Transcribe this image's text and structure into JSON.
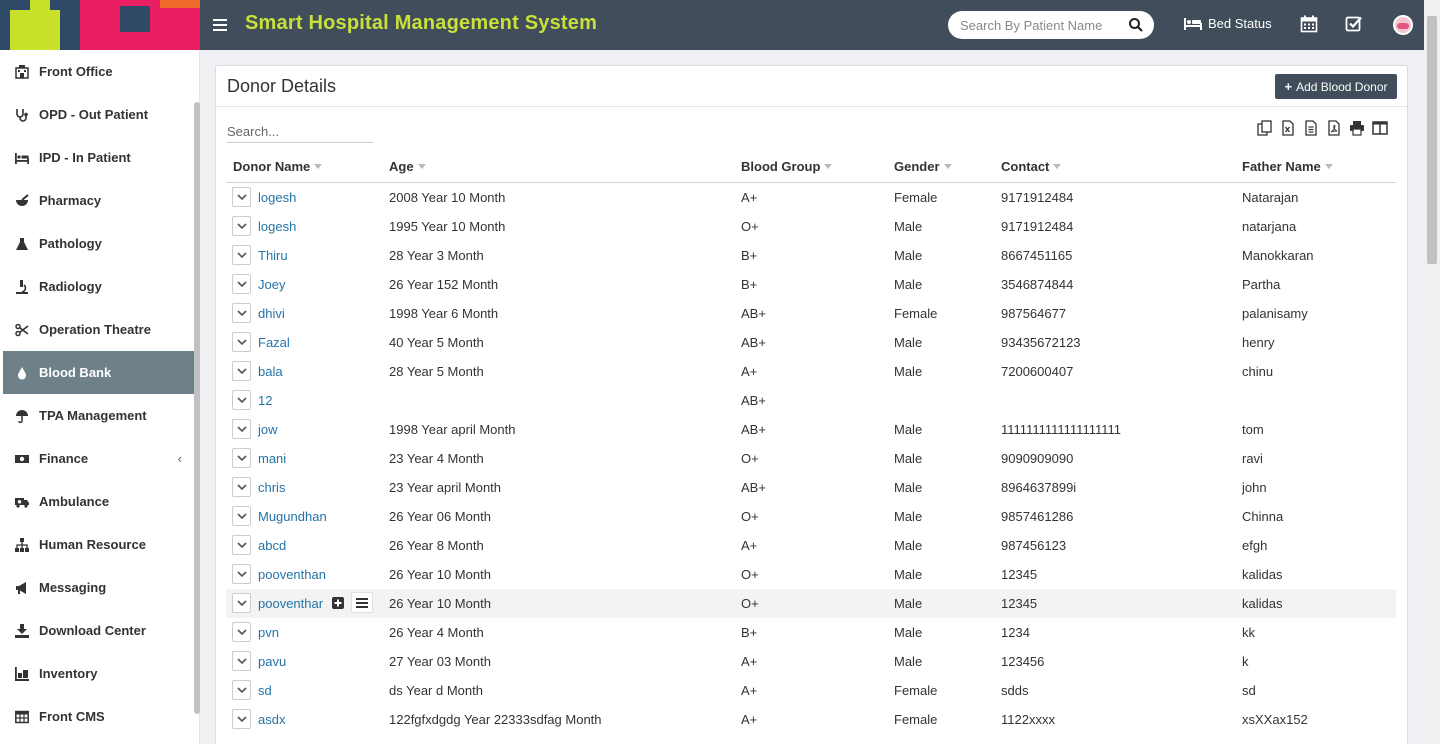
{
  "header": {
    "app_title": "Smart Hospital Management System",
    "search_placeholder": "Search By Patient Name",
    "bed_status_label": "Bed Status"
  },
  "sidebar": {
    "items": [
      {
        "label": "Front Office",
        "icon": "front-office-icon"
      },
      {
        "label": "OPD - Out Patient",
        "icon": "stethoscope-icon"
      },
      {
        "label": "IPD - In Patient",
        "icon": "hospital-bed-icon"
      },
      {
        "label": "Pharmacy",
        "icon": "mortar-pestle-icon"
      },
      {
        "label": "Pathology",
        "icon": "flask-icon"
      },
      {
        "label": "Radiology",
        "icon": "microscope-icon"
      },
      {
        "label": "Operation Theatre",
        "icon": "scissors-icon"
      },
      {
        "label": "Blood Bank",
        "icon": "blood-drop-icon",
        "active": true
      },
      {
        "label": "TPA Management",
        "icon": "umbrella-icon"
      },
      {
        "label": "Finance",
        "icon": "money-icon",
        "has_submenu": true
      },
      {
        "label": "Ambulance",
        "icon": "ambulance-icon"
      },
      {
        "label": "Human Resource",
        "icon": "sitemap-icon"
      },
      {
        "label": "Messaging",
        "icon": "bullhorn-icon"
      },
      {
        "label": "Download Center",
        "icon": "download-icon"
      },
      {
        "label": "Inventory",
        "icon": "inventory-icon"
      },
      {
        "label": "Front CMS",
        "icon": "cms-icon"
      }
    ]
  },
  "main": {
    "title": "Donor Details",
    "add_button_label": "Add Blood Donor",
    "table_search_placeholder": "Search...",
    "columns": [
      "Donor Name",
      "Age",
      "Blood Group",
      "Gender",
      "Contact",
      "Father Name"
    ],
    "rows": [
      [
        "logesh",
        "2008 Year 10 Month",
        "A+",
        "Female",
        "9171912484",
        "Natarajan"
      ],
      [
        "logesh",
        "1995 Year 10 Month",
        "O+",
        "Male",
        "9171912484",
        "natarjana"
      ],
      [
        "Thiru",
        "28 Year 3 Month",
        "B+",
        "Male",
        "8667451165",
        "Manokkaran"
      ],
      [
        "Joey",
        "26 Year 152 Month",
        "B+",
        "Male",
        "3546874844",
        "Partha"
      ],
      [
        "dhivi",
        "1998 Year 6 Month",
        "AB+",
        "Female",
        "987564677",
        "palanisamy"
      ],
      [
        "Fazal",
        "40 Year 5 Month",
        "AB+",
        "Male",
        "93435672123",
        "henry"
      ],
      [
        "bala",
        "28 Year 5 Month",
        "A+",
        "Male",
        "7200600407",
        "chinu"
      ],
      [
        "12",
        "",
        "AB+",
        "",
        "",
        ""
      ],
      [
        "jow",
        "1998 Year april Month",
        "AB+",
        "Male",
        "1111111111111111111",
        "tom"
      ],
      [
        "mani",
        "23 Year 4 Month",
        "O+",
        "Male",
        "9090909090",
        "ravi"
      ],
      [
        "chris",
        "23 Year april Month",
        "AB+",
        "Male",
        "8964637899i",
        "john"
      ],
      [
        "Mugundhan",
        "26 Year 06 Month",
        "O+",
        "Male",
        "9857461286",
        "Chinna"
      ],
      [
        "abcd",
        "26 Year 8 Month",
        "A+",
        "Male",
        "987456123",
        "efgh"
      ],
      [
        "pooventhan",
        "26 Year 10 Month",
        "O+",
        "Male",
        "12345",
        "kalidas"
      ],
      [
        "pooventhan",
        "26 Year 10 Month",
        "O+",
        "Male",
        "12345",
        "kalidas"
      ],
      [
        "pvn",
        "26 Year 4 Month",
        "B+",
        "Male",
        "1234",
        "kk"
      ],
      [
        "pavu",
        "27 Year 03 Month",
        "A+",
        "Male",
        "123456",
        "k"
      ],
      [
        "sd",
        "ds Year d Month",
        "A+",
        "Female",
        "sdds",
        "sd"
      ],
      [
        "asdx",
        "122fgfxdgdg Year 22333sdfag Month",
        "A+",
        "Female",
        "1122xxxx",
        "xsXXax152"
      ]
    ],
    "hovered_row_index": 14
  },
  "colors": {
    "header_bg": "#414d5b",
    "title_accent": "#c8e03a",
    "active_sidebar_bg": "#6e8188",
    "link": "#2574a9"
  }
}
